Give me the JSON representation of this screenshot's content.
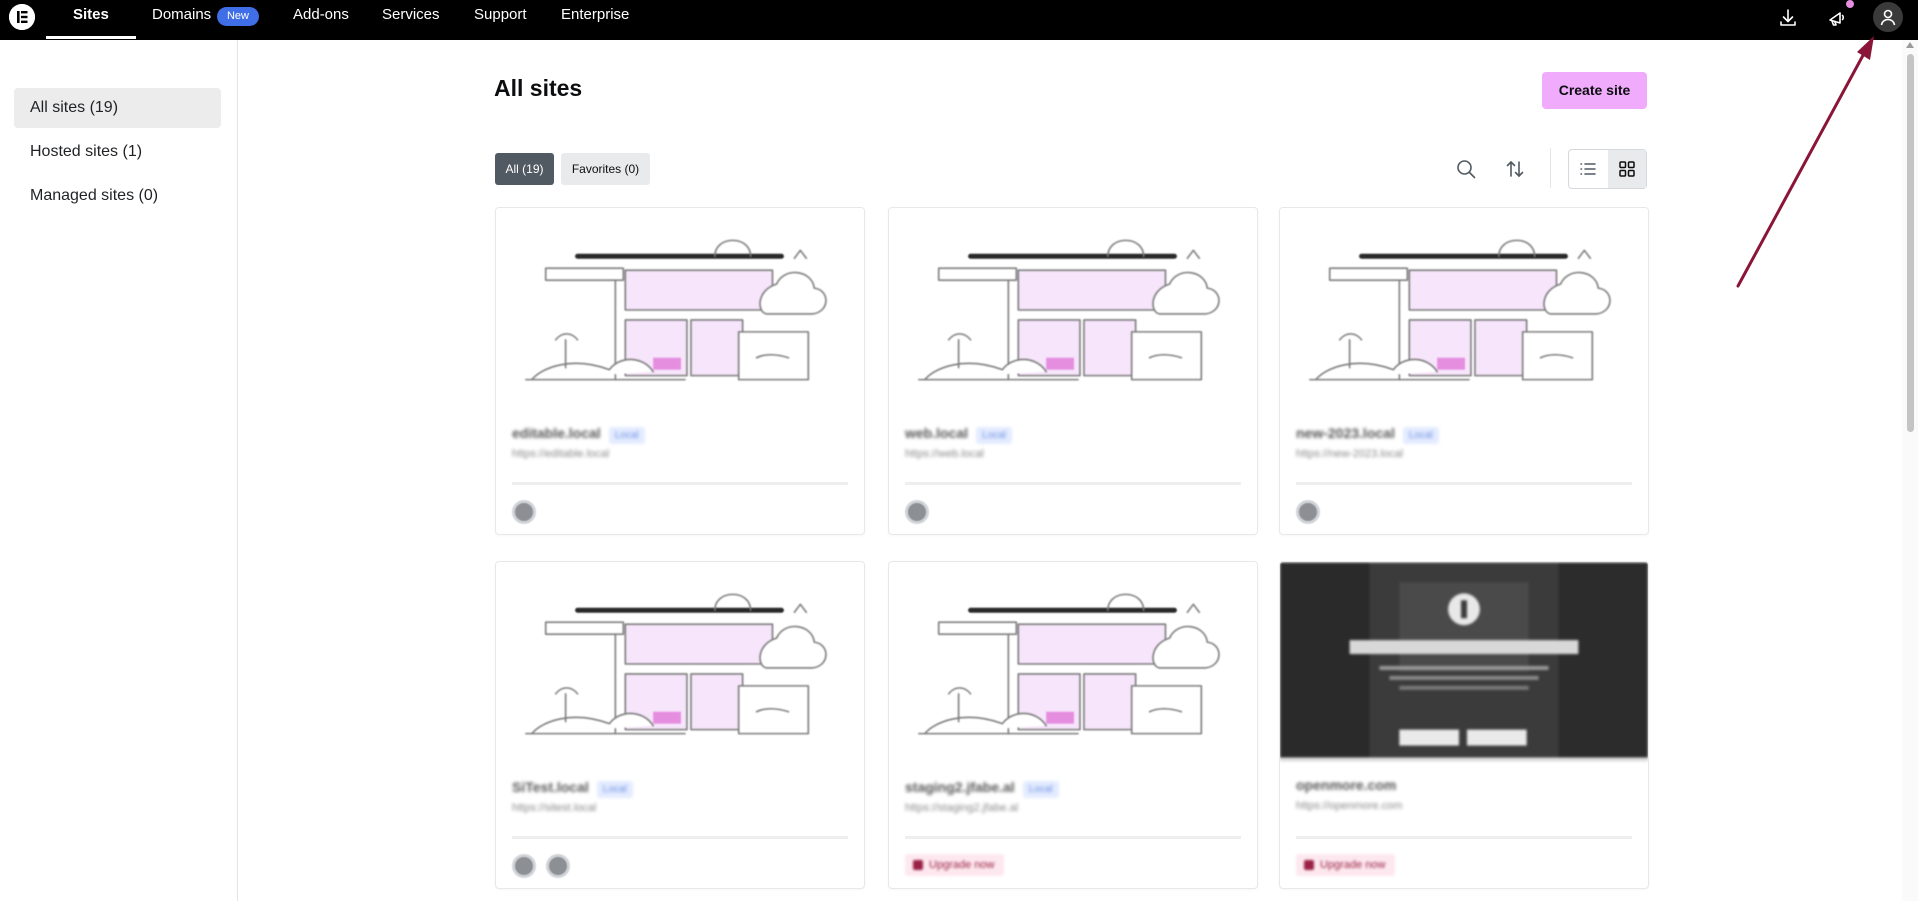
{
  "topbar": {
    "nav": [
      {
        "label": "Sites",
        "active": true
      },
      {
        "label": "Domains"
      },
      {
        "label": "Add-ons"
      },
      {
        "label": "Services"
      },
      {
        "label": "Support"
      },
      {
        "label": "Enterprise"
      }
    ],
    "domains_badge": "New",
    "icons": [
      "elementor-logo-icon",
      "download-icon",
      "megaphone-icon",
      "user-avatar-icon"
    ]
  },
  "sidebar": {
    "items": [
      {
        "label": "All sites (19)",
        "active": true
      },
      {
        "label": "Hosted sites (1)"
      },
      {
        "label": "Managed sites (0)"
      }
    ]
  },
  "main": {
    "title": "All sites",
    "create_button": "Create site",
    "filters": [
      {
        "label": "All (19)",
        "active": true
      },
      {
        "label": "Favorites (0)"
      }
    ],
    "tools": [
      "search-icon",
      "sort-icon"
    ],
    "view_modes": [
      "list-view-icon",
      "grid-view-icon"
    ],
    "active_view": "grid"
  },
  "cards": [
    {
      "name": "editable.local",
      "tag": "Local",
      "url": "https://editable.local"
    },
    {
      "name": "web.local",
      "tag": "Local",
      "url": "https://web.local"
    },
    {
      "name": "new-2023.local",
      "tag": "Local",
      "url": "https://new-2023.local"
    },
    {
      "name": "SiTest.local",
      "tag": "Local",
      "url": "https://sitest.local"
    },
    {
      "name": "staging2.jfabe.al",
      "tag": "Local",
      "url": "https://staging2.jfabe.al"
    },
    {
      "name": "openmore.com",
      "tag": "",
      "url": "https://openmore.com"
    }
  ],
  "card_badges": {
    "upgrade": "Upgrade now"
  },
  "colors": {
    "topbar_bg": "#000000",
    "accent_pink": "#f0abfc",
    "badge_blue": "#3f6ee6",
    "chip_active": "#515962",
    "annotation_arrow": "#8a1538"
  }
}
